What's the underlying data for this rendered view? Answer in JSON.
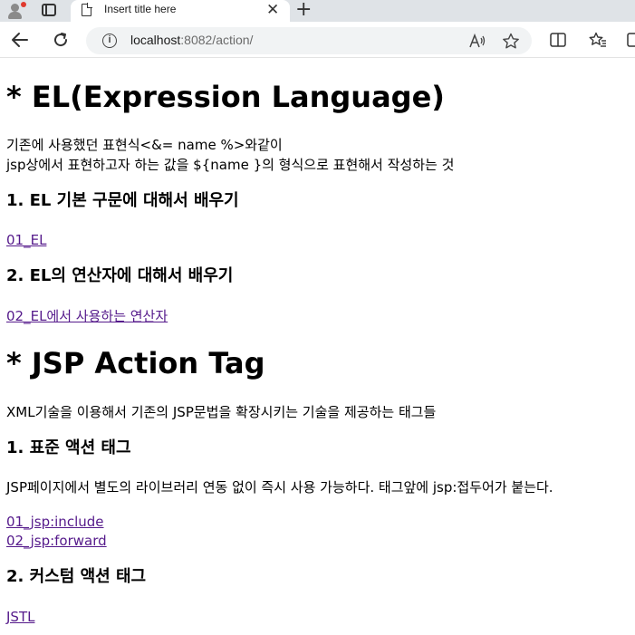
{
  "browser": {
    "tab_title": "Insert title here",
    "tab_close": "✕",
    "new_tab": "+",
    "url_host": "localhost",
    "url_rest": ":8082/action/",
    "icons": [
      "profile-icon",
      "tab-actions-icon",
      "page-icon",
      "close-icon",
      "new-tab-icon",
      "back-icon",
      "refresh-icon",
      "info-icon",
      "read-aloud-icon",
      "favorite-icon",
      "split-screen-icon",
      "favorites-icon",
      "collections-icon"
    ]
  },
  "page": {
    "el_title": "* EL(Expression Language)",
    "el_desc_line1": "기존에 사용했던 표현식<&= name %>와같이",
    "el_desc_line2": "jsp상에서 표현하고자 하는 값을 ${name }의 형식으로 표현해서 작성하는 것",
    "el_h1": "1. EL 기본 구문에 대해서 배우기",
    "el_link1": "01_EL",
    "el_h2": "2. EL의 연산자에 대해서 배우기",
    "el_link2": "02_EL에서 사용하는 연산자",
    "jsp_title": "* JSP Action Tag",
    "jsp_desc": "XML기술을 이용해서 기존의 JSP문법을 확장시키는 기술을 제공하는 태그들",
    "std_h": "1. 표준 액션 태그",
    "std_desc": "JSP페이지에서 별도의 라이브러리 연동 없이 즉시 사용 가능하다. 태그앞에 jsp:접두어가 붙는다.",
    "std_link1": "01_jsp:include",
    "std_link2": "02_jsp:forward",
    "custom_h": "2. 커스텀 액션 태그",
    "custom_link": "JSTL"
  },
  "colors": {
    "visited_link": "#551a8b",
    "tabstrip": "#dfe3e7"
  }
}
